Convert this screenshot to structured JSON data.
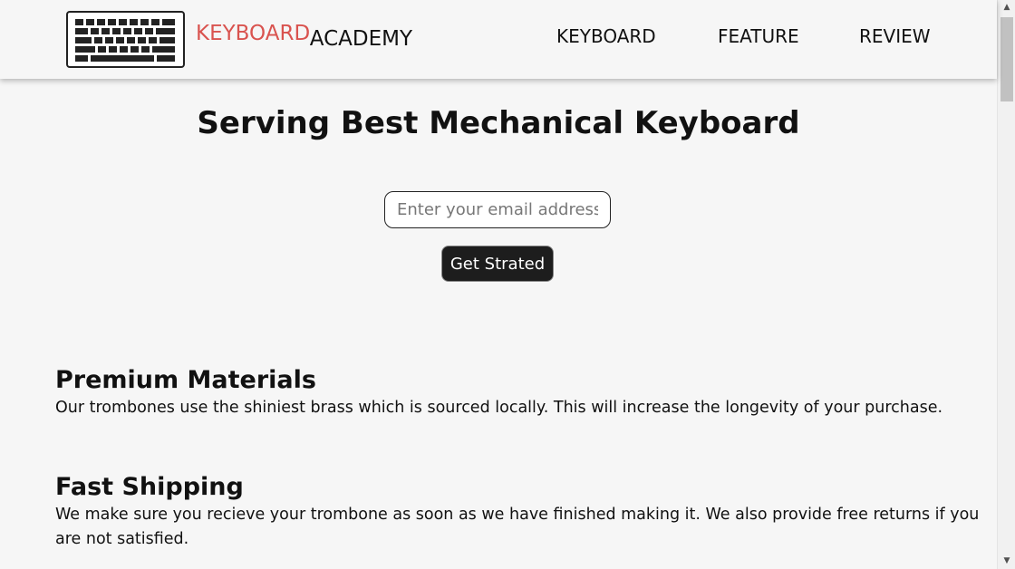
{
  "header": {
    "brand_primary": "KEYBOARD",
    "brand_secondary": "ACADEMY",
    "logo_icon": "keyboard-icon",
    "nav": [
      {
        "label": "KEYBOARD"
      },
      {
        "label": "FEATURE"
      },
      {
        "label": "REVIEW"
      }
    ]
  },
  "hero": {
    "title": "Serving Best Mechanical Keyboard",
    "email_placeholder": "Enter your email address",
    "email_value": "",
    "cta_label": "Get Strated"
  },
  "features": [
    {
      "title": "Premium Materials",
      "text": "Our trombones use the shiniest brass which is sourced locally. This will increase the longevity of your purchase."
    },
    {
      "title": "Fast Shipping",
      "text": "We make sure you recieve your trombone as soon as we have finished making it. We also provide free returns if you are not satisfied."
    }
  ],
  "colors": {
    "brand_accent": "#d9534f",
    "button_bg": "#1d1d1d",
    "page_bg": "#f6f6f6"
  }
}
